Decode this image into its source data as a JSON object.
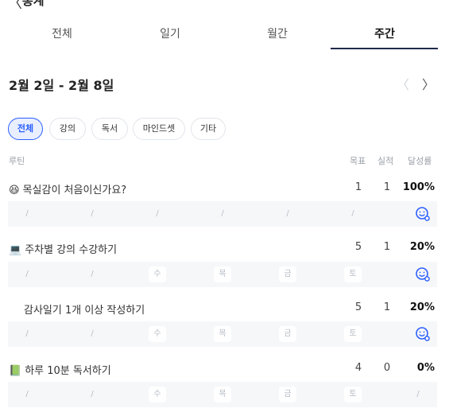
{
  "header": {
    "back_glyph": "〈",
    "title": "통계"
  },
  "tabs": [
    {
      "label": "전체"
    },
    {
      "label": "일기"
    },
    {
      "label": "월간"
    },
    {
      "label": "주간",
      "active": true
    }
  ],
  "week": {
    "range": "2월 2일 - 2월 8일",
    "prev_glyph": "〈",
    "next_glyph": "〉"
  },
  "filters": [
    {
      "label": "전체",
      "active": true
    },
    {
      "label": "강의"
    },
    {
      "label": "독서"
    },
    {
      "label": "마인드셋"
    },
    {
      "label": "기타"
    }
  ],
  "columns": {
    "routine": "루틴",
    "goal": "목표",
    "actual": "실적",
    "rate": "달성률"
  },
  "routines": [
    {
      "icon": "😆",
      "icon_name": "grinning-face-icon",
      "title": "목실감이 처음이신가요?",
      "goal": "1",
      "actual": "1",
      "rate": "100%",
      "days": [
        "/",
        "/",
        "/",
        "/",
        "/",
        "/",
        "smiley"
      ]
    },
    {
      "icon": "💻",
      "icon_name": "laptop-icon",
      "title": "주차별 강의 수강하기",
      "goal": "5",
      "actual": "1",
      "rate": "20%",
      "days": [
        "/",
        "/",
        "수",
        "목",
        "금",
        "토",
        "smiley"
      ]
    },
    {
      "icon": "",
      "icon_name": "",
      "title": "감사일기 1개 이상 작성하기",
      "goal": "5",
      "actual": "1",
      "rate": "20%",
      "days": [
        "/",
        "/",
        "수",
        "목",
        "금",
        "토",
        "smiley"
      ]
    },
    {
      "icon": "📗",
      "icon_name": "book-icon",
      "title": "하루 10분 독서하기",
      "goal": "4",
      "actual": "0",
      "rate": "0%",
      "days": [
        "/",
        "/",
        "수",
        "목",
        "금",
        "토",
        "/"
      ]
    }
  ],
  "colors": {
    "accent": "#2b5fff",
    "tab_underline": "#1e2a4a",
    "row_bg": "#f6f7f9"
  }
}
